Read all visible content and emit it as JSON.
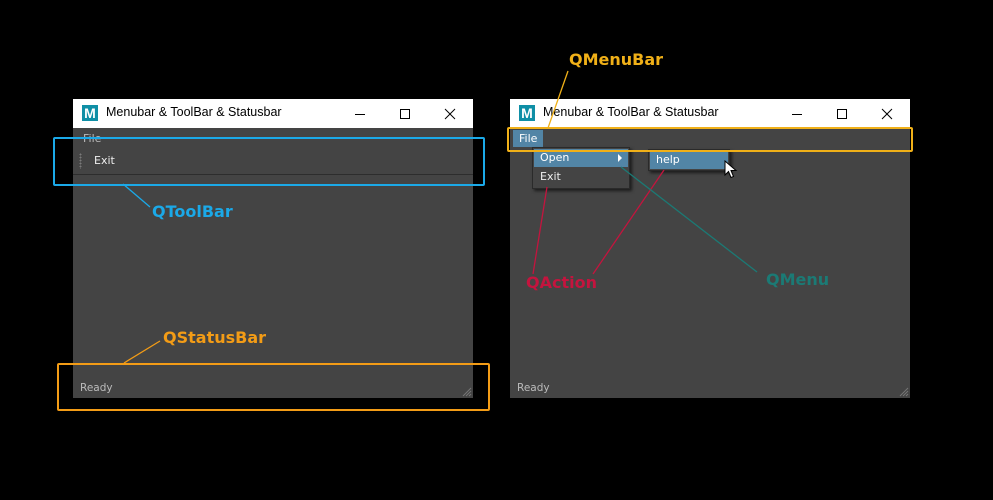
{
  "colors": {
    "toolbar_callout": "#1ba9e8",
    "statusbar_callout": "#f39c16",
    "menubar_callout": "#f0b018",
    "action_callout": "#c4143e",
    "menu_callout": "#1b7a75",
    "highlight": "#5285a6"
  },
  "left_window": {
    "icon": {
      "name": "maya-m-icon",
      "glyph": "M"
    },
    "title": "Menubar & ToolBar & Statusbar",
    "menubar": {
      "file_label": "File"
    },
    "toolbar": {
      "grip_icon": "toolbar-grip-icon",
      "exit_label": "Exit"
    },
    "status": "Ready",
    "window_buttons": [
      "minimize-icon",
      "maximize-icon",
      "close-icon"
    ]
  },
  "right_window": {
    "icon": {
      "name": "maya-m-icon",
      "glyph": "M"
    },
    "title": "Menubar & ToolBar & Statusbar",
    "menubar": {
      "file_label": "File"
    },
    "file_menu": {
      "items": [
        "Open",
        "Exit"
      ],
      "open_arrow_icon": "submenu-arrow-icon"
    },
    "open_submenu": {
      "items": [
        "help"
      ]
    },
    "status": "Ready",
    "window_buttons": [
      "minimize-icon",
      "maximize-icon",
      "close-icon"
    ]
  },
  "annotations": {
    "toolbar": "QToolBar",
    "statusbar": "QStatusBar",
    "menubar": "QMenuBar",
    "action": "QAction",
    "menu": "QMenu"
  }
}
